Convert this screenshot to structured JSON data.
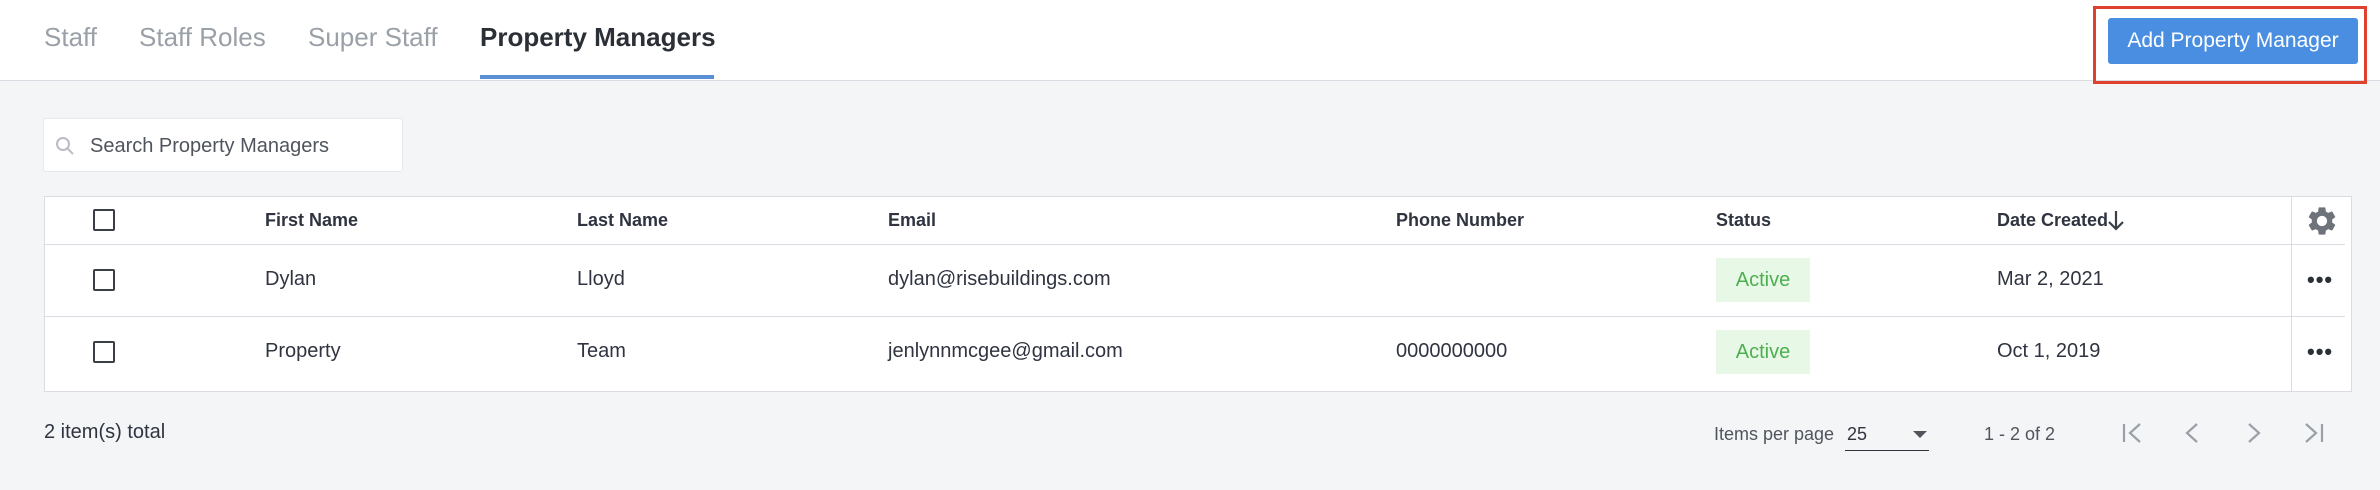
{
  "tabs": [
    {
      "label": "Staff",
      "active": false
    },
    {
      "label": "Staff Roles",
      "active": false
    },
    {
      "label": "Super Staff",
      "active": false
    },
    {
      "label": "Property Managers",
      "active": true
    }
  ],
  "add_button_label": "Add Property Manager",
  "search": {
    "placeholder": "Search Property Managers",
    "value": ""
  },
  "table": {
    "columns": [
      "First Name",
      "Last Name",
      "Email",
      "Phone Number",
      "Status",
      "Date Created"
    ],
    "sort_icon": "arrow-down-icon",
    "settings_icon": "gear-icon",
    "rows": [
      {
        "first_name": "Dylan",
        "last_name": "Lloyd",
        "email": "dylan@risebuildings.com",
        "phone": "",
        "status": "Active",
        "date_created": "Mar 2, 2021",
        "actions_label": "•••"
      },
      {
        "first_name": "Property",
        "last_name": "Team",
        "email": "jenlynnmcgee@gmail.com",
        "phone": "0000000000",
        "status": "Active",
        "date_created": "Oct 1, 2019",
        "actions_label": "•••"
      }
    ]
  },
  "footer": {
    "total_text": "2 item(s) total",
    "items_per_page_label": "Items per page",
    "items_per_page_value": "25",
    "range_text": "1 - 2 of 2"
  },
  "colors": {
    "accent": "#4a8ee2",
    "highlight_border": "#e0412e",
    "status_bg": "#e8f8e6",
    "status_text": "#4caf50"
  }
}
